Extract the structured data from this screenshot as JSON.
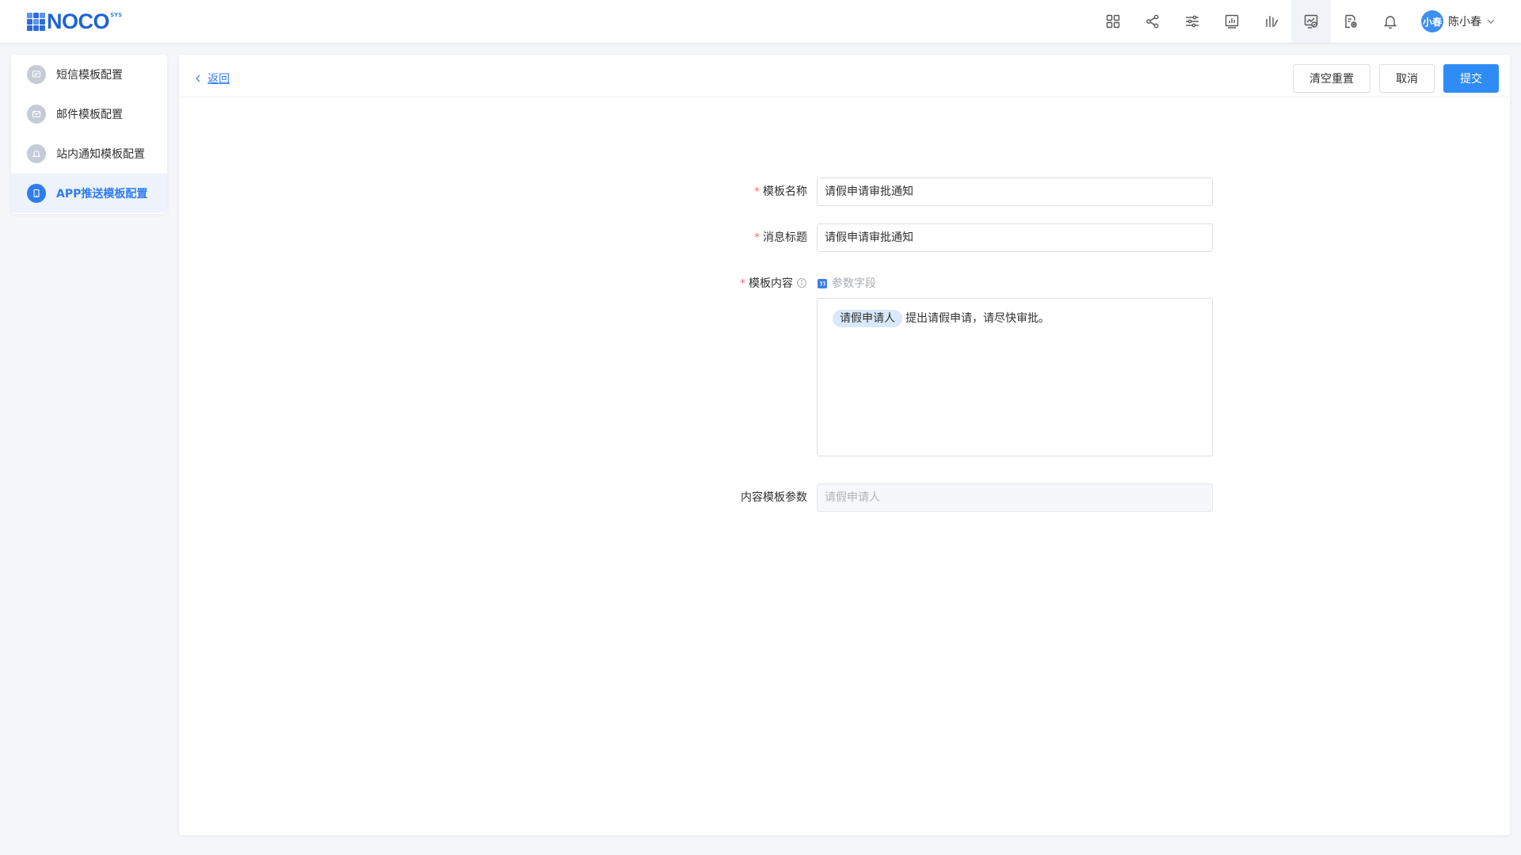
{
  "header": {
    "logo_text": "NOCO",
    "logo_sup": "SYS",
    "icons": [
      "apps-icon",
      "share-icon",
      "sliders-icon",
      "chart-icon",
      "bar-chart-icon",
      "monitor-check-icon",
      "document-gear-icon",
      "bell-icon"
    ],
    "active_icon": "monitor-check-icon",
    "user": {
      "avatar_text": "小春",
      "name": "陈小春"
    },
    "colors": {
      "brand": "#1e63d6",
      "avatar_bg": "#3d8ef0"
    }
  },
  "sidebar": {
    "items": [
      {
        "label": "短信模板配置",
        "icon": "message-icon",
        "active": false
      },
      {
        "label": "邮件模板配置",
        "icon": "mail-icon",
        "active": false
      },
      {
        "label": "站内通知模板配置",
        "icon": "bell-icon",
        "active": false
      },
      {
        "label": "APP推送模板配置",
        "icon": "phone-icon",
        "active": true
      }
    ],
    "active_color": "#2f7cf0"
  },
  "toolbar": {
    "back_label": "返回",
    "clear_label": "清空重置",
    "cancel_label": "取消",
    "submit_label": "提交"
  },
  "form": {
    "template_name": {
      "label": "模板名称",
      "required": true,
      "value": "请假申请审批通知"
    },
    "message_title": {
      "label": "消息标题",
      "required": true,
      "value": "请假申请审批通知"
    },
    "template_content": {
      "label": "模板内容",
      "required": true,
      "param_button": "参数字段",
      "chip": "请假申请人",
      "text": "提出请假申请，请尽快审批。"
    },
    "content_params": {
      "label": "内容模板参数",
      "required": false,
      "placeholder": "请假申请人",
      "disabled": true
    }
  }
}
